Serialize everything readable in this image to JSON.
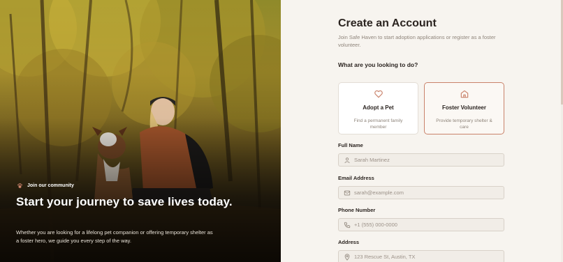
{
  "hero": {
    "badge": "Join our community",
    "title": "Start your journey to save lives today.",
    "text": "Whether you are looking for a lifelong pet companion or offering temporary shelter as a foster hero, we guide you every step of the way."
  },
  "form": {
    "title": "Create an Account",
    "subtitle": "Join Safe Haven to start adoption applications or register as a foster volunteer.",
    "question": "What are you looking to do?",
    "options": [
      {
        "title": "Adopt a Pet",
        "description": "Find a permanent family member",
        "icon": "heart-icon",
        "selected": false
      },
      {
        "title": "Foster Volunteer",
        "description": "Provide temporary shelter & care",
        "icon": "home-icon",
        "selected": true
      }
    ],
    "fields": {
      "full_name": {
        "label": "Full Name",
        "placeholder": "Sarah Martinez",
        "icon": "user-icon"
      },
      "email": {
        "label": "Email Address",
        "placeholder": "sarah@example.com",
        "icon": "mail-icon"
      },
      "phone": {
        "label": "Phone Number",
        "placeholder": "+1 (555) 000-0000",
        "icon": "phone-icon"
      },
      "address": {
        "label": "Address",
        "placeholder": "123 Rescue St, Austin, TX",
        "icon": "map-pin-icon"
      }
    }
  },
  "colors": {
    "accent": "#c9826a",
    "page_bg": "#f7f4ef",
    "text_dark": "#2b2420",
    "text_muted": "#8f857b"
  }
}
